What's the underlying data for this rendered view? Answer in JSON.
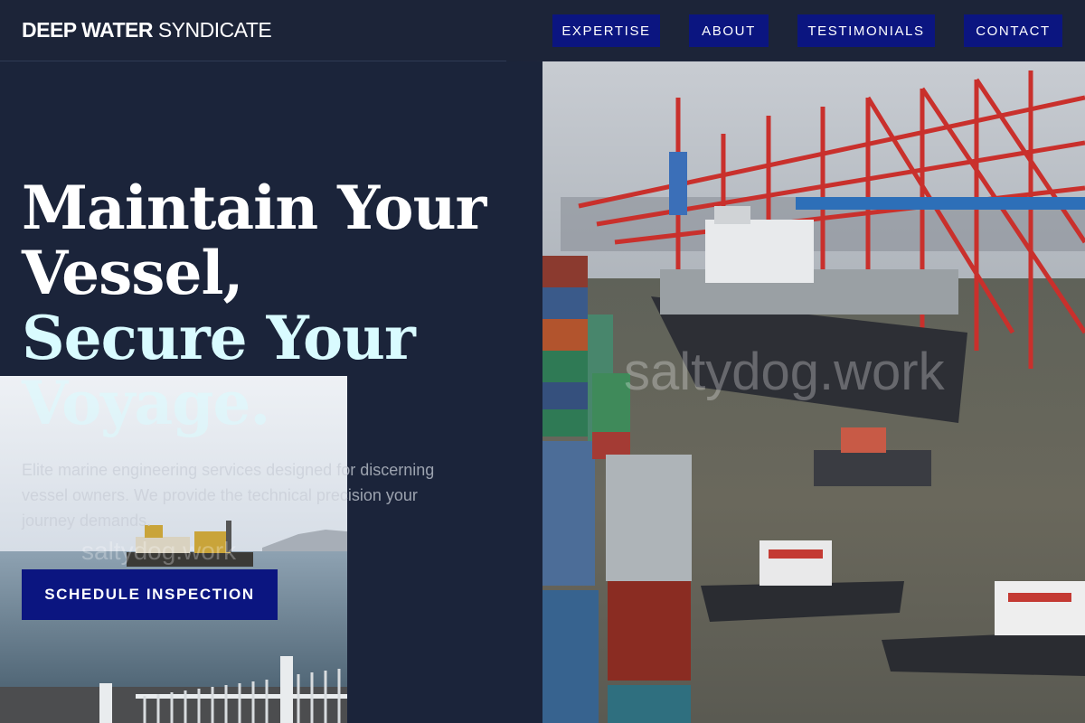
{
  "brand": {
    "bold": "DEEP WATER",
    "light": "SYNDICATE"
  },
  "nav": {
    "expertise": "EXPERTISE",
    "about": "ABOUT",
    "testimonials": "TESTIMONIALS",
    "contact": "CONTACT"
  },
  "hero": {
    "title_line1": "Maintain Your",
    "title_line2": "Vessel,",
    "title_line3": "Secure Your",
    "title_line4": "Voyage.",
    "subtitle": "Elite marine engineering services designed for discerning vessel owners. We provide the technical precision your journey demands.",
    "cta": "SCHEDULE INSPECTION"
  },
  "images": {
    "watermark": "saltydog.work"
  },
  "colors": {
    "background": "#1b243a",
    "header": "#1c2438",
    "button": "#0b1580",
    "accent_text": "#d9fbff"
  }
}
